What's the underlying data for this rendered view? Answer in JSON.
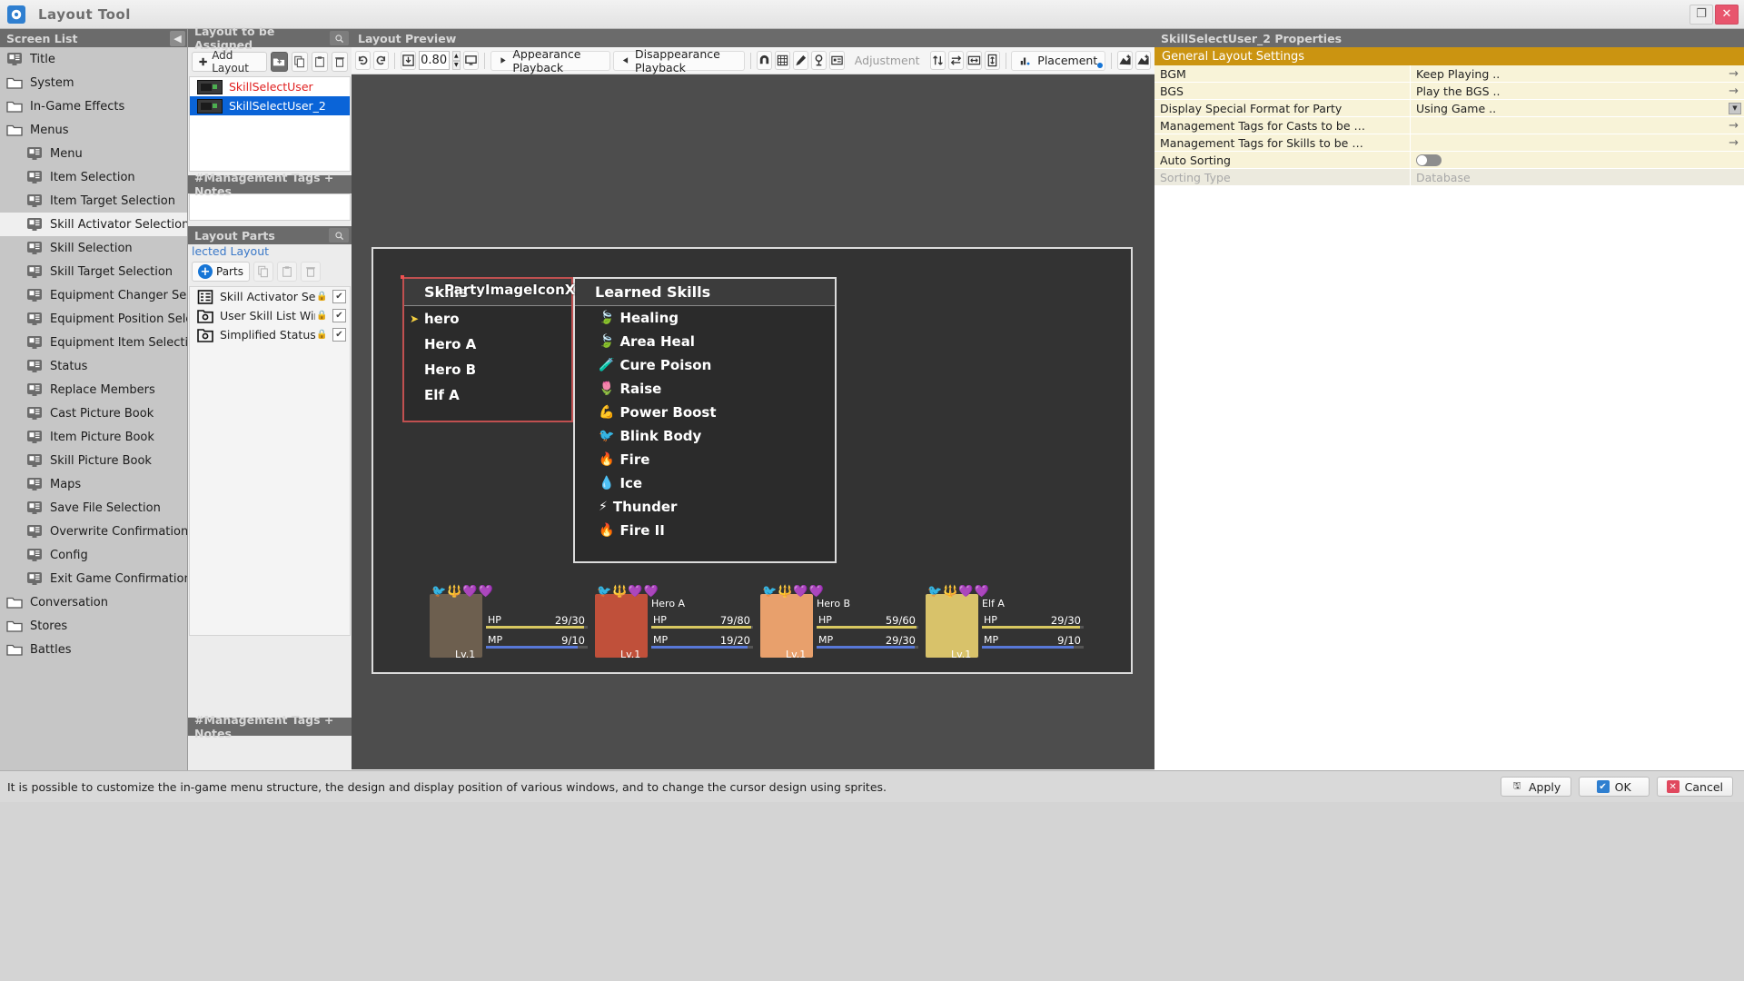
{
  "app": {
    "title": "Layout Tool",
    "icon": "app-icon"
  },
  "window_controls": {
    "restore": "❐",
    "close": "✕"
  },
  "screen_list": {
    "header": "Screen List",
    "collapse_icon": "chevron-left-icon",
    "items": [
      {
        "label": "Title",
        "icon": "screen-icon",
        "indent": 0,
        "selected": false
      },
      {
        "label": "System",
        "icon": "folder-icon",
        "indent": 0,
        "selected": false
      },
      {
        "label": "In-Game Effects",
        "icon": "folder-icon",
        "indent": 0,
        "selected": false
      },
      {
        "label": "Menus",
        "icon": "folder-icon",
        "indent": 0,
        "selected": false
      },
      {
        "label": "Menu",
        "icon": "screen-icon",
        "indent": 1,
        "selected": false
      },
      {
        "label": "Item Selection",
        "icon": "screen-icon",
        "indent": 1,
        "selected": false
      },
      {
        "label": "Item Target Selection",
        "icon": "screen-icon",
        "indent": 1,
        "selected": false
      },
      {
        "label": "Skill Activator Selection",
        "icon": "screen-icon",
        "indent": 1,
        "selected": true
      },
      {
        "label": "Skill Selection",
        "icon": "screen-icon",
        "indent": 1,
        "selected": false
      },
      {
        "label": "Skill Target Selection",
        "icon": "screen-icon",
        "indent": 1,
        "selected": false
      },
      {
        "label": "Equipment Changer Selection",
        "icon": "screen-icon",
        "indent": 1,
        "selected": false
      },
      {
        "label": "Equipment Position Selection",
        "icon": "screen-icon",
        "indent": 1,
        "selected": false
      },
      {
        "label": "Equipment Item Selection",
        "icon": "screen-icon",
        "indent": 1,
        "selected": false
      },
      {
        "label": "Status",
        "icon": "screen-icon",
        "indent": 1,
        "selected": false
      },
      {
        "label": "Replace Members",
        "icon": "screen-icon",
        "indent": 1,
        "selected": false
      },
      {
        "label": "Cast Picture Book",
        "icon": "screen-icon",
        "indent": 1,
        "selected": false
      },
      {
        "label": "Item Picture Book",
        "icon": "screen-icon",
        "indent": 1,
        "selected": false
      },
      {
        "label": "Skill Picture Book",
        "icon": "screen-icon",
        "indent": 1,
        "selected": false
      },
      {
        "label": "Maps",
        "icon": "screen-icon",
        "indent": 1,
        "selected": false
      },
      {
        "label": "Save File Selection",
        "icon": "screen-icon",
        "indent": 1,
        "selected": false
      },
      {
        "label": "Overwrite Confirmation",
        "icon": "screen-icon",
        "indent": 1,
        "selected": false
      },
      {
        "label": "Config",
        "icon": "screen-icon",
        "indent": 1,
        "selected": false
      },
      {
        "label": "Exit Game Confirmation",
        "icon": "screen-icon",
        "indent": 1,
        "selected": false
      },
      {
        "label": "Conversation",
        "icon": "folder-icon",
        "indent": 0,
        "selected": false
      },
      {
        "label": "Stores",
        "icon": "folder-icon",
        "indent": 0,
        "selected": false
      },
      {
        "label": "Battles",
        "icon": "folder-icon",
        "indent": 0,
        "selected": false
      }
    ]
  },
  "layout_assign": {
    "header": "Layout to be Assigned",
    "search_icon": "search-icon",
    "add_button": "Add Layout",
    "tool_icons": [
      "new-folder-icon",
      "copy-icon",
      "paste-icon",
      "delete-icon"
    ],
    "rows": [
      {
        "name": "SkillSelectUser",
        "selected": false
      },
      {
        "name": "SkillSelectUser_2",
        "selected": true
      }
    ],
    "mgmt_header": "#Management Tags + Notes"
  },
  "layout_parts": {
    "header": "Layout Parts",
    "search_icon": "search-icon",
    "subtitle": "lected Layout",
    "add_button": "Parts",
    "tool_icons": [
      "copy-icon",
      "paste-icon",
      "delete-icon"
    ],
    "rows": [
      {
        "name": "Skill Activator Sel…",
        "icon": "list-window-icon",
        "lock": "lock-icon",
        "checked": true
      },
      {
        "name": "User Skill List Win…",
        "icon": "window-part-icon",
        "lock": "lock-icon",
        "checked": true
      },
      {
        "name": "Simplified Status",
        "icon": "window-part-icon",
        "lock": "lock-icon",
        "checked": true
      }
    ],
    "mgmt_header": "#Management Tags + Notes"
  },
  "preview": {
    "header": "Layout Preview",
    "zoom": "0.80",
    "appearance_playback": "Appearance Playback",
    "disappearance_playback": "Disappearance Playback",
    "adjustment": "Adjustment",
    "placement": "Placement",
    "icons": {
      "undo": "undo-icon",
      "redo": "redo-icon",
      "fit": "fit-icon",
      "display": "monitor-icon",
      "play": "play-icon",
      "play_back": "play-back-icon",
      "magnet": "magnet-icon",
      "grid": "grid-icon",
      "pen": "pen-icon",
      "pin": "pin-icon",
      "card": "card-icon",
      "swap_v": "swap-vertical-icon",
      "swap_h": "swap-horizontal-icon",
      "fit_w": "fit-width-icon",
      "fit_h": "fit-height-icon",
      "export": "export-icon",
      "import": "import-icon"
    }
  },
  "game_mockup": {
    "skills_window": {
      "title": "Skills",
      "cursor_icon": "cursor-arrow-icon",
      "items": [
        "hero",
        "Hero A",
        "Hero B",
        "Elf A"
      ],
      "selected_index": 0,
      "border_color": "#c05050"
    },
    "learned_window": {
      "title": "Learned Skills",
      "items": [
        {
          "icon": "🍃",
          "label": "Healing"
        },
        {
          "icon": "🍃",
          "label": "Area Heal"
        },
        {
          "icon": "🧪",
          "label": "Cure Poison"
        },
        {
          "icon": "🌷",
          "label": "Raise"
        },
        {
          "icon": "💪",
          "label": "Power Boost"
        },
        {
          "icon": "🐦",
          "label": "Blink Body"
        },
        {
          "icon": "🔥",
          "label": "Fire"
        },
        {
          "icon": "💧",
          "label": "Ice"
        },
        {
          "icon": "⚡",
          "label": "Thunder"
        },
        {
          "icon": "🔥",
          "label": "Fire II"
        }
      ]
    },
    "party_label": "PartyImageIconX",
    "party": [
      {
        "name": "",
        "hp_label": "HP",
        "hp": "29/30",
        "mp_label": "MP",
        "mp": "9/10",
        "lv": "Lv.1",
        "hp_pct": 96,
        "mp_pct": 90,
        "face": "#6d5f4f",
        "states": "🐦🔱💜💜"
      },
      {
        "name": "Hero A",
        "hp_label": "HP",
        "hp": "79/80",
        "mp_label": "MP",
        "mp": "19/20",
        "lv": "Lv.1",
        "hp_pct": 98,
        "mp_pct": 95,
        "face": "#c0503a",
        "states": "🐦🔱💜💜"
      },
      {
        "name": "Hero B",
        "hp_label": "HP",
        "hp": "59/60",
        "mp_label": "MP",
        "mp": "29/30",
        "lv": "Lv.1",
        "hp_pct": 98,
        "mp_pct": 96,
        "face": "#e8a06c",
        "states": "🐦🔱💜💜"
      },
      {
        "name": "Elf A",
        "hp_label": "HP",
        "hp": "29/30",
        "mp_label": "MP",
        "mp": "9/10",
        "lv": "Lv.1",
        "hp_pct": 96,
        "mp_pct": 90,
        "face": "#d8c26a",
        "states": "🐦🔱💜💜"
      }
    ]
  },
  "properties": {
    "header": "SkillSelectUser_2 Properties",
    "section": "General Layout Settings",
    "section_color": "#cb9411",
    "rows": [
      {
        "key": "BGM",
        "value": "Keep Playing ..",
        "control": "arrow",
        "disabled": false
      },
      {
        "key": "BGS",
        "value": "Play the BGS ..",
        "control": "arrow",
        "disabled": false
      },
      {
        "key": "Display Special Format for Party",
        "value": "Using Game ..",
        "control": "drop",
        "disabled": false
      },
      {
        "key": "Management Tags for Casts to be …",
        "value": "",
        "control": "arrow",
        "disabled": false
      },
      {
        "key": "Management Tags for Skills to be …",
        "value": "",
        "control": "arrow",
        "disabled": false
      },
      {
        "key": "Auto Sorting",
        "value": "",
        "control": "toggle",
        "disabled": false
      },
      {
        "key": "Sorting Type",
        "value": "Database",
        "control": "none",
        "disabled": true
      }
    ]
  },
  "statusbar": {
    "message": "It is possible to customize the in-game menu structure, the design and display position of various windows, and to change the cursor design using sprites.",
    "buttons": [
      {
        "label": "Apply",
        "icon": "apply-icon",
        "style": "gray"
      },
      {
        "label": "OK",
        "icon": "check-icon",
        "style": "blue"
      },
      {
        "label": "Cancel",
        "icon": "cross-icon",
        "style": "red"
      }
    ]
  }
}
